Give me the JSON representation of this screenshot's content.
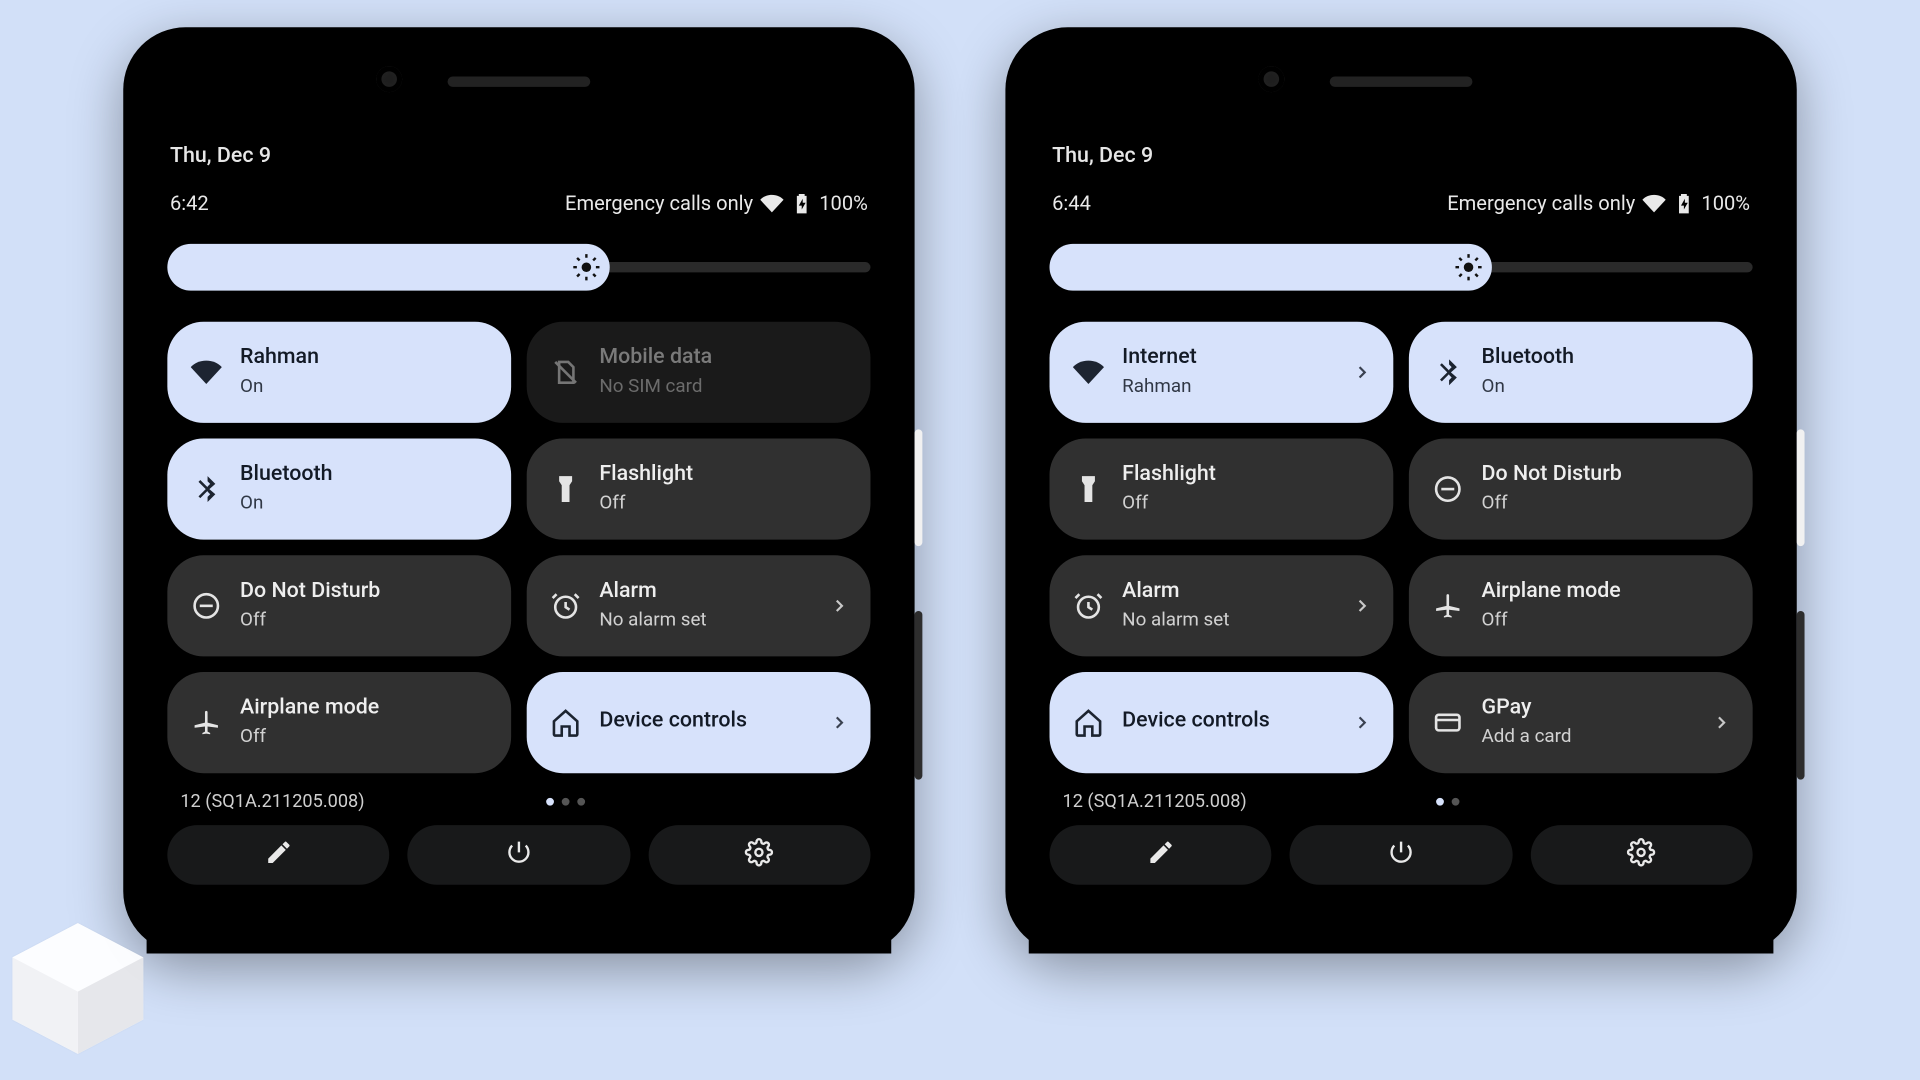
{
  "colors": {
    "accent": "#d7e2fb",
    "tile_inactive": "#303030",
    "tile_disabled": "#1a1a1a",
    "bg": "#d2e0f8"
  },
  "left": {
    "date": "Thu, Dec 9",
    "time": "6:42",
    "status_text": "Emergency calls only",
    "battery_pct": "100%",
    "brightness_pct": 63,
    "build": "12 (SQ1A.211205.008)",
    "page_index": 0,
    "page_count": 3,
    "tiles": [
      {
        "icon": "wifi",
        "title": "Rahman",
        "sub": "On",
        "state": "active"
      },
      {
        "icon": "sim-off",
        "title": "Mobile data",
        "sub": "No SIM card",
        "state": "disabled"
      },
      {
        "icon": "bluetooth",
        "title": "Bluetooth",
        "sub": "On",
        "state": "active"
      },
      {
        "icon": "flashlight",
        "title": "Flashlight",
        "sub": "Off",
        "state": "inactive"
      },
      {
        "icon": "dnd",
        "title": "Do Not Disturb",
        "sub": "Off",
        "state": "inactive"
      },
      {
        "icon": "alarm",
        "title": "Alarm",
        "sub": "No alarm set",
        "state": "inactive",
        "chevron": true
      },
      {
        "icon": "airplane",
        "title": "Airplane mode",
        "sub": "Off",
        "state": "inactive"
      },
      {
        "icon": "home",
        "title": "Device controls",
        "sub": "",
        "state": "active",
        "chevron": true,
        "single": true
      }
    ]
  },
  "right": {
    "date": "Thu, Dec 9",
    "time": "6:44",
    "status_text": "Emergency calls only",
    "battery_pct": "100%",
    "brightness_pct": 63,
    "build": "12 (SQ1A.211205.008)",
    "page_index": 0,
    "page_count": 2,
    "tiles": [
      {
        "icon": "wifi",
        "title": "Internet",
        "sub": "Rahman",
        "state": "active",
        "chevron": true
      },
      {
        "icon": "bluetooth",
        "title": "Bluetooth",
        "sub": "On",
        "state": "active"
      },
      {
        "icon": "flashlight",
        "title": "Flashlight",
        "sub": "Off",
        "state": "inactive"
      },
      {
        "icon": "dnd",
        "title": "Do Not Disturb",
        "sub": "Off",
        "state": "inactive"
      },
      {
        "icon": "alarm",
        "title": "Alarm",
        "sub": "No alarm set",
        "state": "inactive",
        "chevron": true
      },
      {
        "icon": "airplane",
        "title": "Airplane mode",
        "sub": "Off",
        "state": "inactive"
      },
      {
        "icon": "home",
        "title": "Device controls",
        "sub": "",
        "state": "active",
        "chevron": true,
        "single": true
      },
      {
        "icon": "card",
        "title": "GPay",
        "sub": "Add a card",
        "state": "inactive",
        "chevron": true
      }
    ]
  },
  "footer_buttons": [
    "edit",
    "power",
    "settings"
  ]
}
